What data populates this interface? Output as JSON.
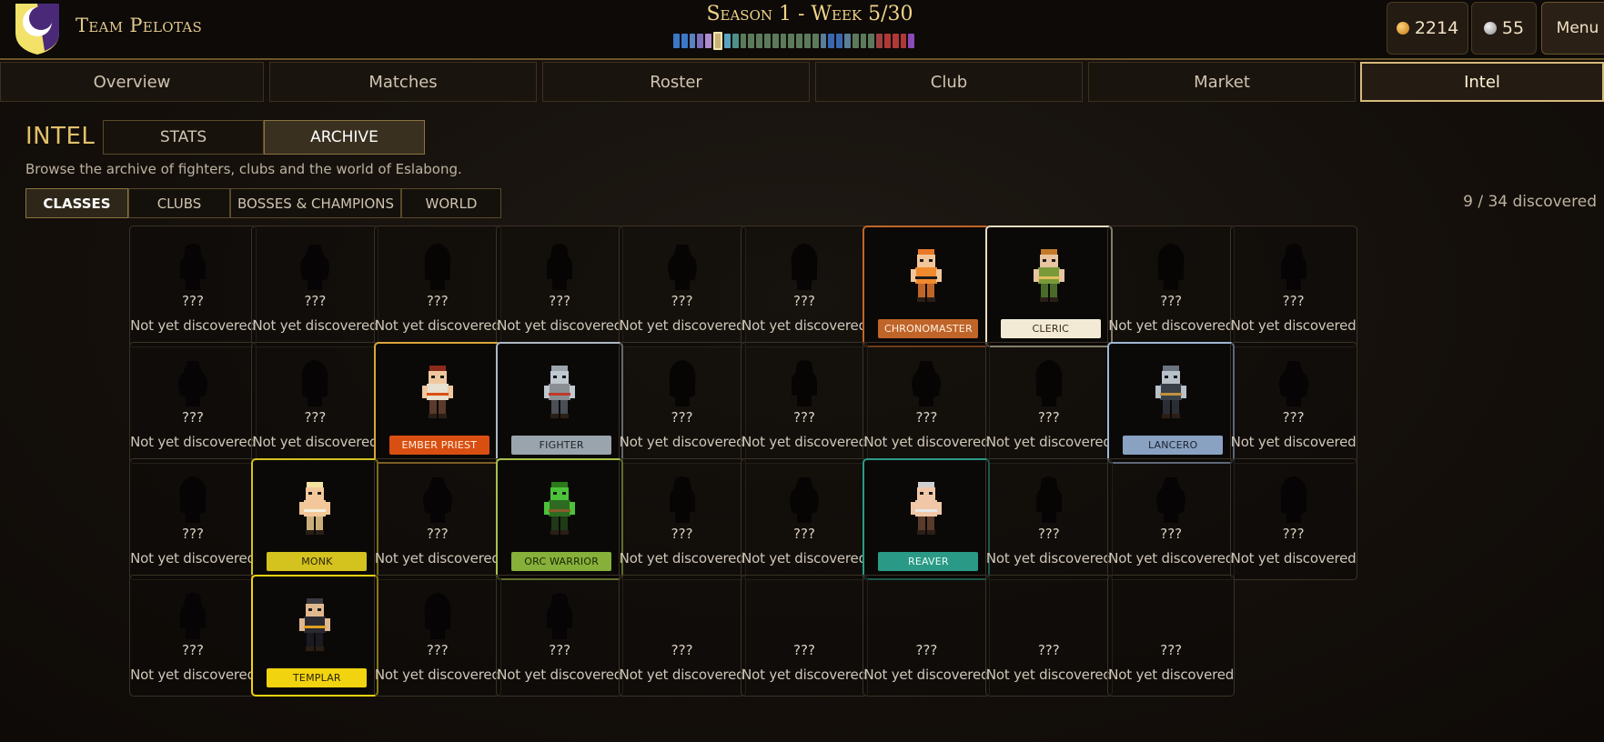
{
  "header": {
    "team_name": "Team Pelotas",
    "season_label": "Season 1 - Week 5/30",
    "gold": "2214",
    "silver": "55",
    "menu_label": "Menu",
    "crest_icon": "team-crest-icon",
    "week_colors": [
      "#3a78c8",
      "#3a78c8",
      "#5a82c0",
      "#7a6fb8",
      "#b08ad0",
      "#c9b27a",
      "#5aa3c0",
      "#4f8f8a",
      "#5c7a5a",
      "#5c7a5a",
      "#5c7a5a",
      "#5c7a5a",
      "#5c7a5a",
      "#5c7a5a",
      "#5c7a5a",
      "#5c7a5a",
      "#5c7a5a",
      "#5c7a5a",
      "#5a7d9a",
      "#3a68b0",
      "#3a68b0",
      "#5a7d9a",
      "#5c7a5a",
      "#5c7a5a",
      "#5c7a5a",
      "#a04040",
      "#b03838",
      "#b03838",
      "#b03838",
      "#8a4ab8"
    ]
  },
  "nav": {
    "tabs": [
      "Overview",
      "Matches",
      "Roster",
      "Club",
      "Market",
      "Intel"
    ],
    "active": "Intel"
  },
  "intel": {
    "title": "INTEL",
    "view_tabs": [
      "STATS",
      "ARCHIVE"
    ],
    "active_view": "ARCHIVE",
    "description": "Browse the archive of fighters, clubs and the world of Eslabong.",
    "sub_tabs": [
      "CLASSES",
      "CLUBS",
      "BOSSES & CHAMPIONS",
      "WORLD"
    ],
    "active_sub_tab": "CLASSES",
    "discovered_count": "9 / 34 discovered"
  },
  "archive": {
    "unknown_name": "???",
    "unknown_status": "Not yet discovered",
    "cards": [
      {
        "discovered": false
      },
      {
        "discovered": false
      },
      {
        "discovered": false
      },
      {
        "discovered": false
      },
      {
        "discovered": false
      },
      {
        "discovered": false
      },
      {
        "discovered": true,
        "name": "CHRONOMASTER",
        "color": "#c0652a",
        "text_color": "#fff1e0",
        "border": "#c0652a",
        "sprite": "chronomaster-sprite"
      },
      {
        "discovered": true,
        "name": "CLERIC",
        "color": "#f3ead6",
        "text_color": "#3a2a14",
        "border": "#e8dcc0",
        "sprite": "cleric-sprite"
      },
      {
        "discovered": false
      },
      {
        "discovered": false
      },
      {
        "discovered": false
      },
      {
        "discovered": false
      },
      {
        "discovered": true,
        "name": "EMBER PRIEST",
        "color": "#d94f12",
        "text_color": "#fff1e0",
        "border": "#d9a53a",
        "sprite": "ember-priest-sprite"
      },
      {
        "discovered": true,
        "name": "FIGHTER",
        "color": "#9aa4ad",
        "text_color": "#1e2328",
        "border": "#aeb8c2",
        "sprite": "fighter-sprite"
      },
      {
        "discovered": false
      },
      {
        "discovered": false
      },
      {
        "discovered": false
      },
      {
        "discovered": false
      },
      {
        "discovered": true,
        "name": "LANCERO",
        "color": "#8aa2c2",
        "text_color": "#1b2230",
        "border": "#9fb7d6",
        "sprite": "lancero-sprite"
      },
      {
        "discovered": false
      },
      {
        "discovered": false
      },
      {
        "discovered": true,
        "name": "MONK",
        "color": "#d4c21f",
        "text_color": "#2a2406",
        "border": "#d4c21f",
        "sprite": "monk-sprite"
      },
      {
        "discovered": false
      },
      {
        "discovered": true,
        "name": "ORC WARRIOR",
        "color": "#86b03a",
        "text_color": "#1a2606",
        "border": "#a7c24c",
        "sprite": "orc-warrior-sprite"
      },
      {
        "discovered": false
      },
      {
        "discovered": false
      },
      {
        "discovered": true,
        "name": "REAVER",
        "color": "#2a9a86",
        "text_color": "#eafaf5",
        "border": "#2a9a86",
        "sprite": "reaver-sprite"
      },
      {
        "discovered": false
      },
      {
        "discovered": false
      },
      {
        "discovered": false
      },
      {
        "discovered": false
      },
      {
        "discovered": true,
        "name": "TEMPLAR",
        "color": "#f1d310",
        "text_color": "#2a2406",
        "border": "#f1d310",
        "sprite": "templar-sprite"
      },
      {
        "discovered": false
      },
      {
        "discovered": false
      },
      {
        "discovered": false
      },
      {
        "discovered": false
      },
      {
        "discovered": false
      },
      {
        "discovered": false
      },
      {
        "discovered": false
      }
    ]
  }
}
